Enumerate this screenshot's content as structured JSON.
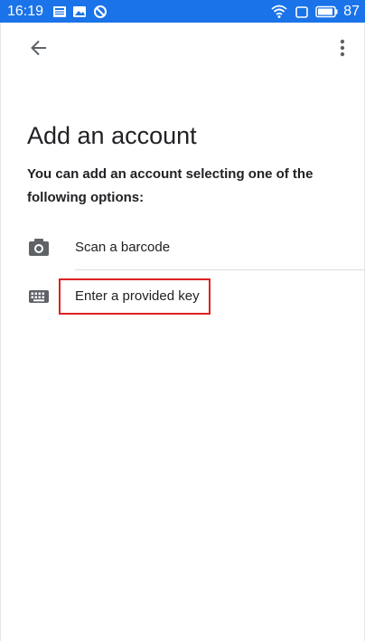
{
  "status_bar": {
    "time": "16:19",
    "battery_level": "87",
    "icons_left": [
      "news-icon",
      "image-icon",
      "do-not-disturb-icon"
    ],
    "icons_right": [
      "wifi-icon",
      "square-icon",
      "battery-icon"
    ],
    "background_color": "#1a73e8"
  },
  "toolbar": {
    "back_icon": "arrow-left-icon",
    "overflow_icon": "more-vert-icon"
  },
  "page": {
    "title": "Add an account",
    "subtitle": "You can add an account selecting one of the following options:"
  },
  "options": [
    {
      "label": "Scan a barcode",
      "icon": "camera-icon"
    },
    {
      "label": "Enter a provided key",
      "icon": "keyboard-icon"
    }
  ],
  "highlight": {
    "target": "Enter a provided key",
    "color": "#e02020"
  }
}
